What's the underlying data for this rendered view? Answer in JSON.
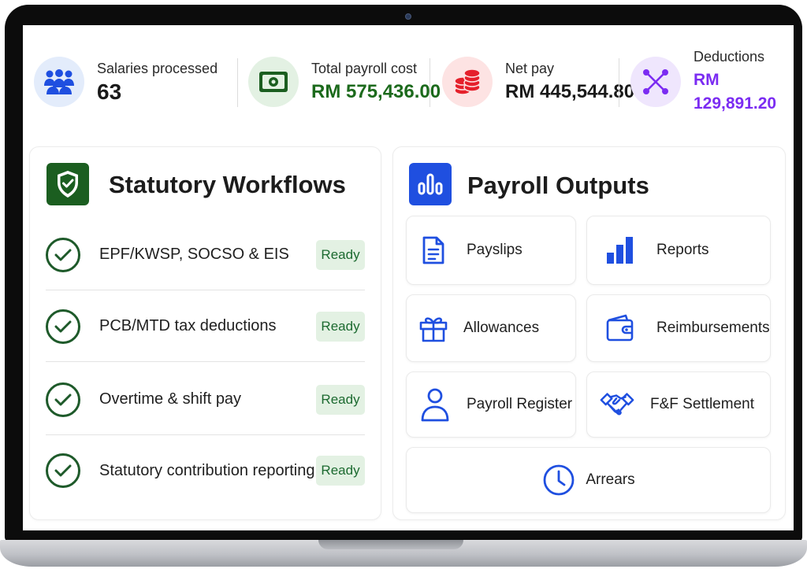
{
  "stats": [
    {
      "label": "Salaries processed",
      "value": "63",
      "icon": "people-icon",
      "color": "#1a1a1a",
      "bg": "#e3ecfb"
    },
    {
      "label": "Total payroll cost",
      "value": "RM 575,436.00",
      "icon": "cash-icon",
      "color": "#1c6a1c",
      "bg": "#e3f1e3"
    },
    {
      "label": "Net pay",
      "value": "RM 445,544.80",
      "icon": "coins-icon",
      "color": "#1a1a1a",
      "bg": "#fde3e3"
    },
    {
      "label": "Deductions",
      "value": "RM 129,891.20",
      "icon": "deductions-icon",
      "color": "#7b2cf2",
      "bg": "#efe6fd"
    }
  ],
  "workflows": {
    "title": "Statutory Workflows",
    "items": [
      {
        "label": "EPF/KWSP, SOCSO & EIS",
        "status": "Ready"
      },
      {
        "label": "PCB/MTD tax deductions",
        "status": "Ready"
      },
      {
        "label": "Overtime & shift pay",
        "status": "Ready"
      },
      {
        "label": "Statutory contribution reporting",
        "status": "Ready"
      }
    ]
  },
  "outputs": {
    "title": "Payroll Outputs",
    "tiles": [
      {
        "label": "Payslips",
        "icon": "document-icon"
      },
      {
        "label": "Reports",
        "icon": "bar-chart-icon"
      },
      {
        "label": "Allowances",
        "icon": "gift-icon"
      },
      {
        "label": "Reimbursements",
        "icon": "wallet-icon"
      },
      {
        "label": "Payroll Register",
        "icon": "user-icon"
      },
      {
        "label": "F&F Settlement",
        "icon": "handshake-icon"
      },
      {
        "label": "Arrears",
        "icon": "clock-icon"
      }
    ]
  },
  "colors": {
    "green_dark": "#1b5e20",
    "blue": "#1f4fe0",
    "purple": "#7b2cf2",
    "red": "#e5202b"
  }
}
